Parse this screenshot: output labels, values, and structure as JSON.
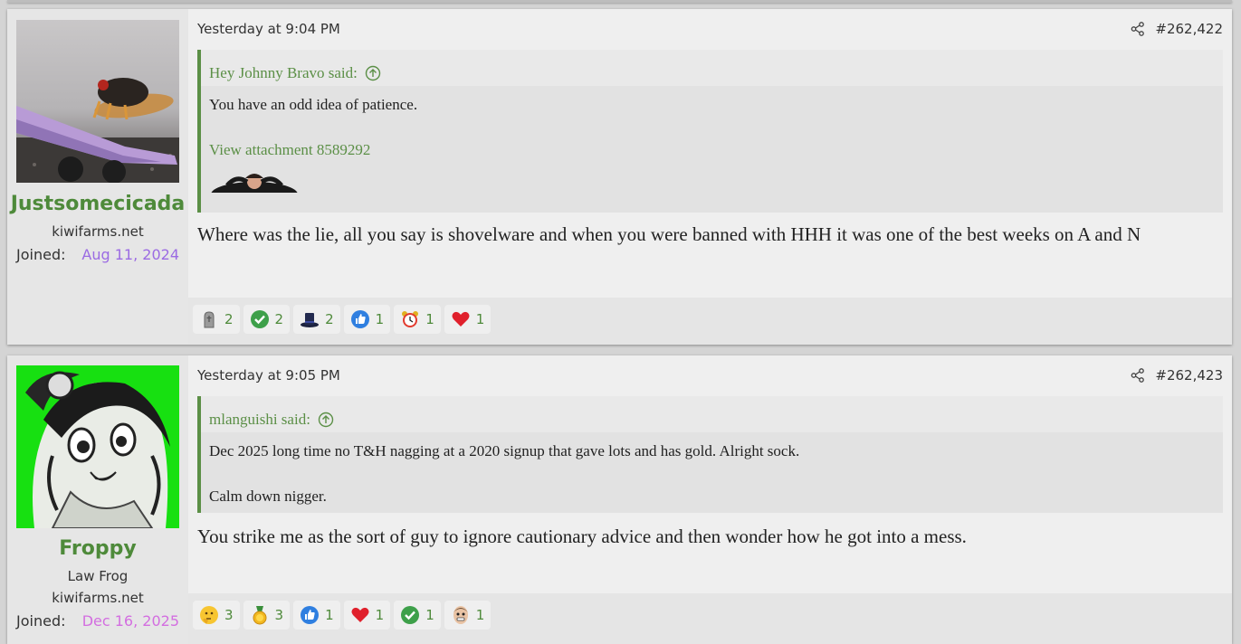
{
  "posts": [
    {
      "user": {
        "name": "Justsomecicada",
        "banner": "kiwifarms.net",
        "joined_label": "Joined:",
        "joined_date": "Aug 11, 2024",
        "joined_color": "#9b6be3"
      },
      "date": "Yesterday at 9:04 PM",
      "number": "#262,422",
      "quote": {
        "author": "Hey Johnny Bravo said:",
        "lines": [
          "You have an odd idea of patience.",
          "View attachment 8589292"
        ]
      },
      "text": "Where was the lie, all you say is shovelware and when you were banned with HHH it was one of the best weeks on A and N",
      "reactions": [
        {
          "icon": "tombstone-icon",
          "count": "2"
        },
        {
          "icon": "green-check-icon",
          "count": "2"
        },
        {
          "icon": "top-hat-icon",
          "count": "2"
        },
        {
          "icon": "thumbs-up-icon",
          "count": "1"
        },
        {
          "icon": "alarm-clock-icon",
          "count": "1"
        },
        {
          "icon": "heart-icon",
          "count": "1"
        }
      ]
    },
    {
      "user": {
        "name": "Froppy",
        "title": "Law Frog",
        "banner": "kiwifarms.net",
        "joined_label": "Joined:",
        "joined_date": "Dec 16, 2025",
        "joined_color": "#d36ee0"
      },
      "date": "Yesterday at 9:05 PM",
      "number": "#262,423",
      "quote": {
        "author": "mlanguishi said:",
        "lines": [
          "Dec 2025 long time no T&H nagging at a 2020 signup that gave lots and has gold. Alright sock.",
          "Calm down nigger."
        ]
      },
      "text": "You strike me as the sort of guy to ignore cautionary advice and then wonder how he got into a mess.",
      "reactions": [
        {
          "icon": "thinking-face-icon",
          "count": "3"
        },
        {
          "icon": "gold-medal-icon",
          "count": "3"
        },
        {
          "icon": "thumbs-up-icon",
          "count": "1"
        },
        {
          "icon": "heart-icon",
          "count": "1"
        },
        {
          "icon": "green-check-icon",
          "count": "1"
        },
        {
          "icon": "face-icon",
          "count": "1"
        }
      ]
    }
  ],
  "colors": {
    "accent": "#5b8f46",
    "username": "#4e8a3a"
  }
}
